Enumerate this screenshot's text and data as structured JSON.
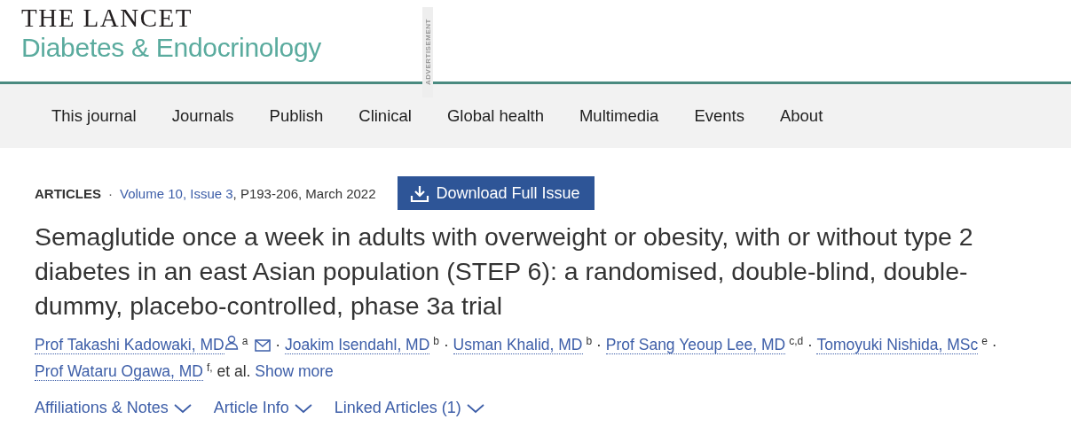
{
  "header": {
    "logo_top": "THE LANCET",
    "logo_bottom": "Diabetes & Endocrinology",
    "ad_label": "ADVERTISEMENT"
  },
  "nav": [
    {
      "label": "This journal"
    },
    {
      "label": "Journals"
    },
    {
      "label": "Publish"
    },
    {
      "label": "Clinical"
    },
    {
      "label": "Global health"
    },
    {
      "label": "Multimedia"
    },
    {
      "label": "Events"
    },
    {
      "label": "About"
    }
  ],
  "article": {
    "section": "ARTICLES",
    "separator": "·",
    "issue_link": "Volume 10, Issue 3",
    "citation": ", P193-206, March 2022",
    "download_button": "Download Full Issue",
    "title": "Semaglutide once a week in adults with overweight or obesity, with or without type 2 diabetes in an east Asian population (STEP 6): a randomised, double-blind, double-dummy, placebo-controlled, phase 3a trial",
    "authors": [
      {
        "name": "Prof Takashi Kadowaki, MD",
        "person_icon": true,
        "affiliation": "a",
        "mail_icon": true,
        "separator": "·"
      },
      {
        "name": "Joakim Isendahl, MD",
        "person_icon": false,
        "affiliation": "b",
        "mail_icon": false,
        "separator": "·"
      },
      {
        "name": "Usman Khalid, MD",
        "person_icon": false,
        "affiliation": "b",
        "mail_icon": false,
        "separator": "·"
      },
      {
        "name": "Prof Sang Yeoup Lee, MD",
        "person_icon": false,
        "affiliation": "c,d",
        "mail_icon": false,
        "separator": "·"
      },
      {
        "name": "Tomoyuki Nishida, MSc",
        "person_icon": false,
        "affiliation": "e",
        "mail_icon": false,
        "separator": "·"
      },
      {
        "name": "Prof Wataru Ogawa, MD",
        "person_icon": false,
        "affiliation": "f,",
        "mail_icon": false
      }
    ],
    "et_al": "et al.",
    "show_more": "Show more",
    "toggles": [
      {
        "label": "Affiliations & Notes",
        "expanded": false
      },
      {
        "label": "Article Info",
        "expanded": false
      },
      {
        "label": "Linked Articles (1)",
        "expanded": false
      }
    ]
  }
}
